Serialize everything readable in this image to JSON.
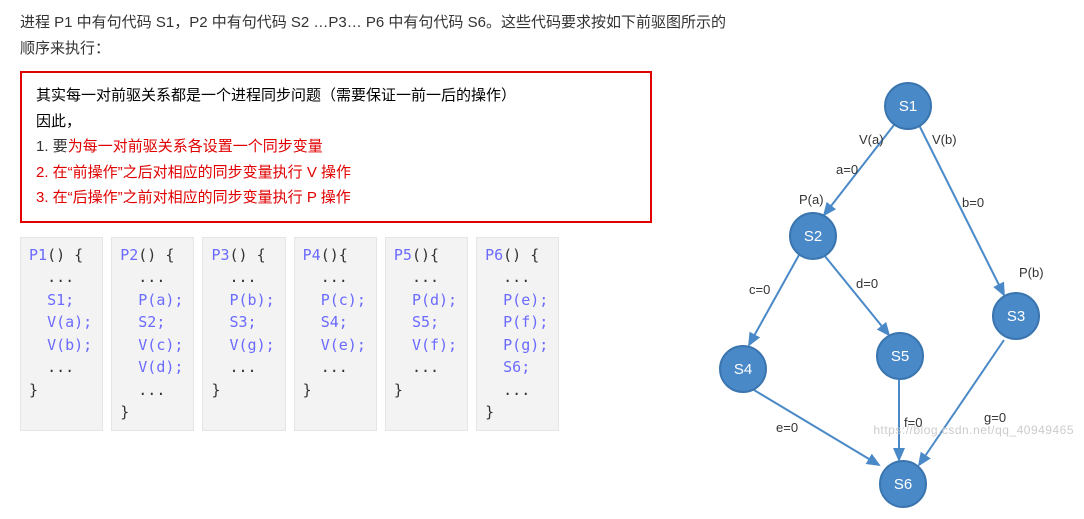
{
  "intro": "进程 P1 中有句代码 S1，P2 中有句代码 S2 …P3… P6 中有句代码 S6。这些代码要求按如下前驱图所示的顺序来执行：",
  "redbox": {
    "lead1": "其实每一对前驱关系都是一个进程同步问题（需要保证一前一后的操作）",
    "lead2": "因此，",
    "line1_pre": "1.  要",
    "line1_red": "为每一对前驱关系各设置一个同步变量",
    "line2": "2.  在“前操作”之后对相应的同步变量执行  V 操作",
    "line3": "3.  在“后操作”之前对相应的同步变量执行  P 操作"
  },
  "code": {
    "p1": {
      "fn": "P1",
      "lines": [
        "...",
        "S1;",
        "V(a);",
        "V(b);",
        "...",
        ""
      ]
    },
    "p2": {
      "fn": "P2",
      "lines": [
        "...",
        "P(a);",
        "S2;",
        "V(c);",
        "V(d);",
        "..."
      ]
    },
    "p3": {
      "fn": "P3",
      "lines": [
        "...",
        "P(b);",
        "S3;",
        "V(g);",
        "...",
        ""
      ]
    },
    "p4": {
      "fn": "P4",
      "lines": [
        "...",
        "P(c);",
        "S4;",
        "V(e);",
        "...",
        ""
      ]
    },
    "p5": {
      "fn": "P5",
      "lines": [
        "...",
        "P(d);",
        "S5;",
        "V(f);",
        "...",
        ""
      ]
    },
    "p6": {
      "fn": "P6",
      "lines": [
        "...",
        "P(e);",
        "P(f);",
        "P(g);",
        "S6;",
        "..."
      ]
    }
  },
  "graph": {
    "nodes": {
      "s1": "S1",
      "s2": "S2",
      "s3": "S3",
      "s4": "S4",
      "s5": "S5",
      "s6": "S6"
    },
    "labels": {
      "va": "V(a)",
      "vb": "V(b)",
      "a0": "a=0",
      "b0": "b=0",
      "pa": "P(a)",
      "pb": "P(b)",
      "c0": "c=0",
      "d0": "d=0",
      "e0": "e=0",
      "f0": "f=0",
      "g0": "g=0"
    }
  },
  "watermark": "https://blog.csdn.net/qq_40949465"
}
